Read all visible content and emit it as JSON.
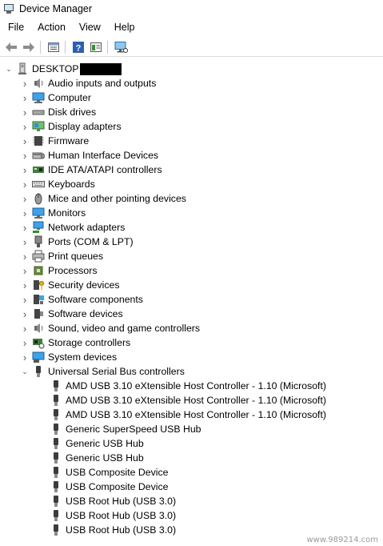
{
  "window": {
    "title": "Device Manager"
  },
  "menu": [
    "File",
    "Action",
    "View",
    "Help"
  ],
  "toolbar": [
    {
      "name": "back-button",
      "icon": "arrow-left-icon"
    },
    {
      "name": "forward-button",
      "icon": "arrow-right-icon"
    },
    {
      "name": "properties-button",
      "icon": "properties-icon"
    },
    {
      "name": "help-button",
      "icon": "help-icon"
    },
    {
      "name": "show-hidden-button",
      "icon": "show-view-icon"
    },
    {
      "name": "scan-hardware-button",
      "icon": "monitor-scan-icon"
    }
  ],
  "tree": {
    "root_label": "DESKTOP",
    "categories": [
      {
        "label": "Audio inputs and outputs",
        "icon": "speaker-icon",
        "expanded": false
      },
      {
        "label": "Computer",
        "icon": "computer-icon",
        "expanded": false
      },
      {
        "label": "Disk drives",
        "icon": "disk-drive-icon",
        "expanded": false
      },
      {
        "label": "Display adapters",
        "icon": "display-adapter-icon",
        "expanded": false
      },
      {
        "label": "Firmware",
        "icon": "firmware-icon",
        "expanded": false
      },
      {
        "label": "Human Interface Devices",
        "icon": "hid-icon",
        "expanded": false
      },
      {
        "label": "IDE ATA/ATAPI controllers",
        "icon": "ide-controller-icon",
        "expanded": false
      },
      {
        "label": "Keyboards",
        "icon": "keyboard-icon",
        "expanded": false
      },
      {
        "label": "Mice and other pointing devices",
        "icon": "mouse-icon",
        "expanded": false
      },
      {
        "label": "Monitors",
        "icon": "monitor-icon",
        "expanded": false
      },
      {
        "label": "Network adapters",
        "icon": "network-adapter-icon",
        "expanded": false
      },
      {
        "label": "Ports (COM & LPT)",
        "icon": "port-icon",
        "expanded": false
      },
      {
        "label": "Print queues",
        "icon": "printer-icon",
        "expanded": false
      },
      {
        "label": "Processors",
        "icon": "processor-icon",
        "expanded": false
      },
      {
        "label": "Security devices",
        "icon": "security-device-icon",
        "expanded": false
      },
      {
        "label": "Software components",
        "icon": "software-component-icon",
        "expanded": false
      },
      {
        "label": "Software devices",
        "icon": "software-device-icon",
        "expanded": false
      },
      {
        "label": "Sound, video and game controllers",
        "icon": "sound-controller-icon",
        "expanded": false
      },
      {
        "label": "Storage controllers",
        "icon": "storage-controller-icon",
        "expanded": false
      },
      {
        "label": "System devices",
        "icon": "system-devices-icon",
        "expanded": false
      },
      {
        "label": "Universal Serial Bus controllers",
        "icon": "usb-icon",
        "expanded": true
      }
    ],
    "usb_devices": [
      "AMD USB 3.10 eXtensible Host Controller - 1.10 (Microsoft)",
      "AMD USB 3.10 eXtensible Host Controller - 1.10 (Microsoft)",
      "AMD USB 3.10 eXtensible Host Controller - 1.10 (Microsoft)",
      "Generic SuperSpeed USB Hub",
      "Generic USB Hub",
      "Generic USB Hub",
      "USB Composite Device",
      "USB Composite Device",
      "USB Root Hub (USB 3.0)",
      "USB Root Hub (USB 3.0)",
      "USB Root Hub (USB 3.0)"
    ]
  },
  "watermark": "www.989214.com"
}
